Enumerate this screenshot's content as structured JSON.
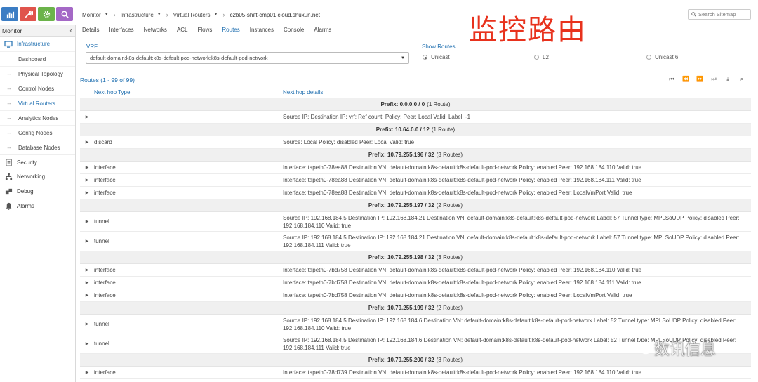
{
  "colors": {
    "tile_monitor": "#3b7dc4",
    "tile_config": "#e0544c",
    "tile_settings": "#6bb34a",
    "tile_query": "#a468c6",
    "link_blue": "#1f6fb0",
    "title_red": "#e8321d"
  },
  "top_icons": [
    "chart-icon",
    "wrench-icon",
    "gear-icon",
    "search-icon"
  ],
  "sidebar": {
    "title": "Monitor",
    "sections": [
      {
        "label": "Infrastructure",
        "icon": "monitor-icon"
      },
      {
        "label": "Security",
        "icon": "security-icon"
      },
      {
        "label": "Networking",
        "icon": "network-icon"
      },
      {
        "label": "Debug",
        "icon": "debug-icon"
      },
      {
        "label": "Alarms",
        "icon": "bell-icon"
      }
    ],
    "infra_items": [
      "Dashboard",
      "Physical Topology",
      "Control Nodes",
      "Virtual Routers",
      "Analytics Nodes",
      "Config Nodes",
      "Database Nodes"
    ]
  },
  "breadcrumb": {
    "monitor": "Monitor",
    "infrastructure": "Infrastructure",
    "virtual_routers": "Virtual Routers",
    "host": "c2b05-shift-cmp01.cloud.shuxun.net"
  },
  "search": {
    "placeholder": "Search Sitemap"
  },
  "tabs": [
    "Details",
    "Interfaces",
    "Networks",
    "ACL",
    "Flows",
    "Routes",
    "Instances",
    "Console",
    "Alarms"
  ],
  "active_tab": "Routes",
  "overlay_title": "监控路由",
  "vrf": {
    "label": "VRF",
    "selected": "default-domain:k8s-default:k8s-default-pod-network:k8s-default-pod-network"
  },
  "show_routes": {
    "label": "Show Routes",
    "options": [
      "Unicast",
      "L2",
      "Unicast 6"
    ],
    "selected": "Unicast"
  },
  "routes": {
    "title": "Routes (1 - 99 of 99)",
    "col_type": "Next hop Type",
    "col_details": "Next hop details",
    "pager_icons": [
      "first-page-icon",
      "prev-page-icon",
      "next-page-icon",
      "last-page-icon",
      "download-icon",
      "search-icon"
    ]
  },
  "groups": [
    {
      "prefix": "Prefix: 0.0.0.0 / 0",
      "count": "(1 Route)",
      "rows": [
        {
          "type": "",
          "details": "Source IP:   Destination IP:   vrf:   Ref count:   Policy:   Peer: Local   Valid:   Label: -1"
        }
      ]
    },
    {
      "prefix": "Prefix: 10.64.0.0 / 12",
      "count": "(1 Route)",
      "rows": [
        {
          "type": "discard",
          "details": "Source: Local   Policy: disabled   Peer: Local   Valid: true"
        }
      ]
    },
    {
      "prefix": "Prefix: 10.79.255.196 / 32",
      "count": "(3 Routes)",
      "rows": [
        {
          "type": "interface",
          "details": "Interface: tapeth0-78ea88   Destination VN: default-domain:k8s-default:k8s-default-pod-network   Policy: enabled   Peer: 192.168.184.110   Valid: true"
        },
        {
          "type": "interface",
          "details": "Interface: tapeth0-78ea88   Destination VN: default-domain:k8s-default:k8s-default-pod-network   Policy: enabled   Peer: 192.168.184.111   Valid: true"
        },
        {
          "type": "interface",
          "details": "Interface: tapeth0-78ea88   Destination VN: default-domain:k8s-default:k8s-default-pod-network   Policy: enabled   Peer: LocalVmPort   Valid: true"
        }
      ]
    },
    {
      "prefix": "Prefix: 10.79.255.197 / 32",
      "count": "(2 Routes)",
      "rows": [
        {
          "type": "tunnel",
          "details": "Source IP: 192.168.184.5   Destination IP: 192.168.184.21   Destination VN: default-domain:k8s-default:k8s-default-pod-network   Label: 57   Tunnel type: MPLSoUDP   Policy: disabled   Peer: 192.168.184.110   Valid: true"
        },
        {
          "type": "tunnel",
          "details": "Source IP: 192.168.184.5   Destination IP: 192.168.184.21   Destination VN: default-domain:k8s-default:k8s-default-pod-network   Label: 57   Tunnel type: MPLSoUDP   Policy: disabled   Peer: 192.168.184.111   Valid: true"
        }
      ]
    },
    {
      "prefix": "Prefix: 10.79.255.198 / 32",
      "count": "(3 Routes)",
      "rows": [
        {
          "type": "interface",
          "details": "Interface: tapeth0-7bd758   Destination VN: default-domain:k8s-default:k8s-default-pod-network   Policy: enabled   Peer: 192.168.184.110   Valid: true"
        },
        {
          "type": "interface",
          "details": "Interface: tapeth0-7bd758   Destination VN: default-domain:k8s-default:k8s-default-pod-network   Policy: enabled   Peer: 192.168.184.111   Valid: true"
        },
        {
          "type": "interface",
          "details": "Interface: tapeth0-7bd758   Destination VN: default-domain:k8s-default:k8s-default-pod-network   Policy: enabled   Peer: LocalVmPort   Valid: true"
        }
      ]
    },
    {
      "prefix": "Prefix: 10.79.255.199 / 32",
      "count": "(2 Routes)",
      "rows": [
        {
          "type": "tunnel",
          "details": "Source IP: 192.168.184.5   Destination IP: 192.168.184.6   Destination VN: default-domain:k8s-default:k8s-default-pod-network   Label: 52   Tunnel type: MPLSoUDP   Policy: disabled   Peer: 192.168.184.110   Valid: true"
        },
        {
          "type": "tunnel",
          "details": "Source IP: 192.168.184.5   Destination IP: 192.168.184.6   Destination VN: default-domain:k8s-default:k8s-default-pod-network   Label: 52   Tunnel type: MPLSoUDP   Policy: disabled   Peer: 192.168.184.111   Valid: true"
        }
      ]
    },
    {
      "prefix": "Prefix: 10.79.255.200 / 32",
      "count": "(3 Routes)",
      "rows": [
        {
          "type": "interface",
          "details": "Interface: tapeth0-78d739   Destination VN: default-domain:k8s-default:k8s-default-pod-network   Policy: enabled   Peer: 192.168.184.110   Valid: true"
        }
      ]
    }
  ],
  "watermark": "数讯信息"
}
